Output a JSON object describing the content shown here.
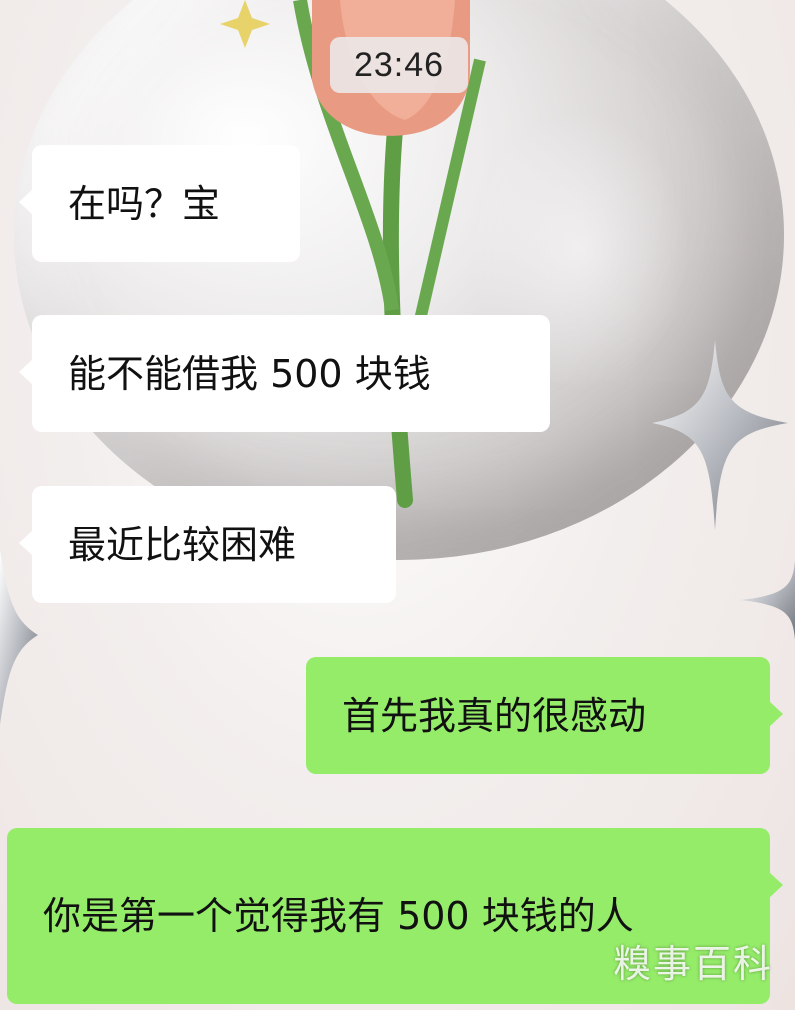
{
  "status": {
    "time": "23:46"
  },
  "messages": [
    {
      "side": "in",
      "text": "在吗？宝"
    },
    {
      "side": "in",
      "text": "能不能借我 500 块钱"
    },
    {
      "side": "in",
      "text": "最近比较困难"
    },
    {
      "side": "out",
      "text": "首先我真的很感动"
    },
    {
      "side": "out",
      "text": "你是第一个觉得我有 500 块钱的人"
    }
  ],
  "watermark": "糗事百科",
  "colors": {
    "incoming_bubble": "#ffffff",
    "outgoing_bubble": "#95ec69"
  }
}
